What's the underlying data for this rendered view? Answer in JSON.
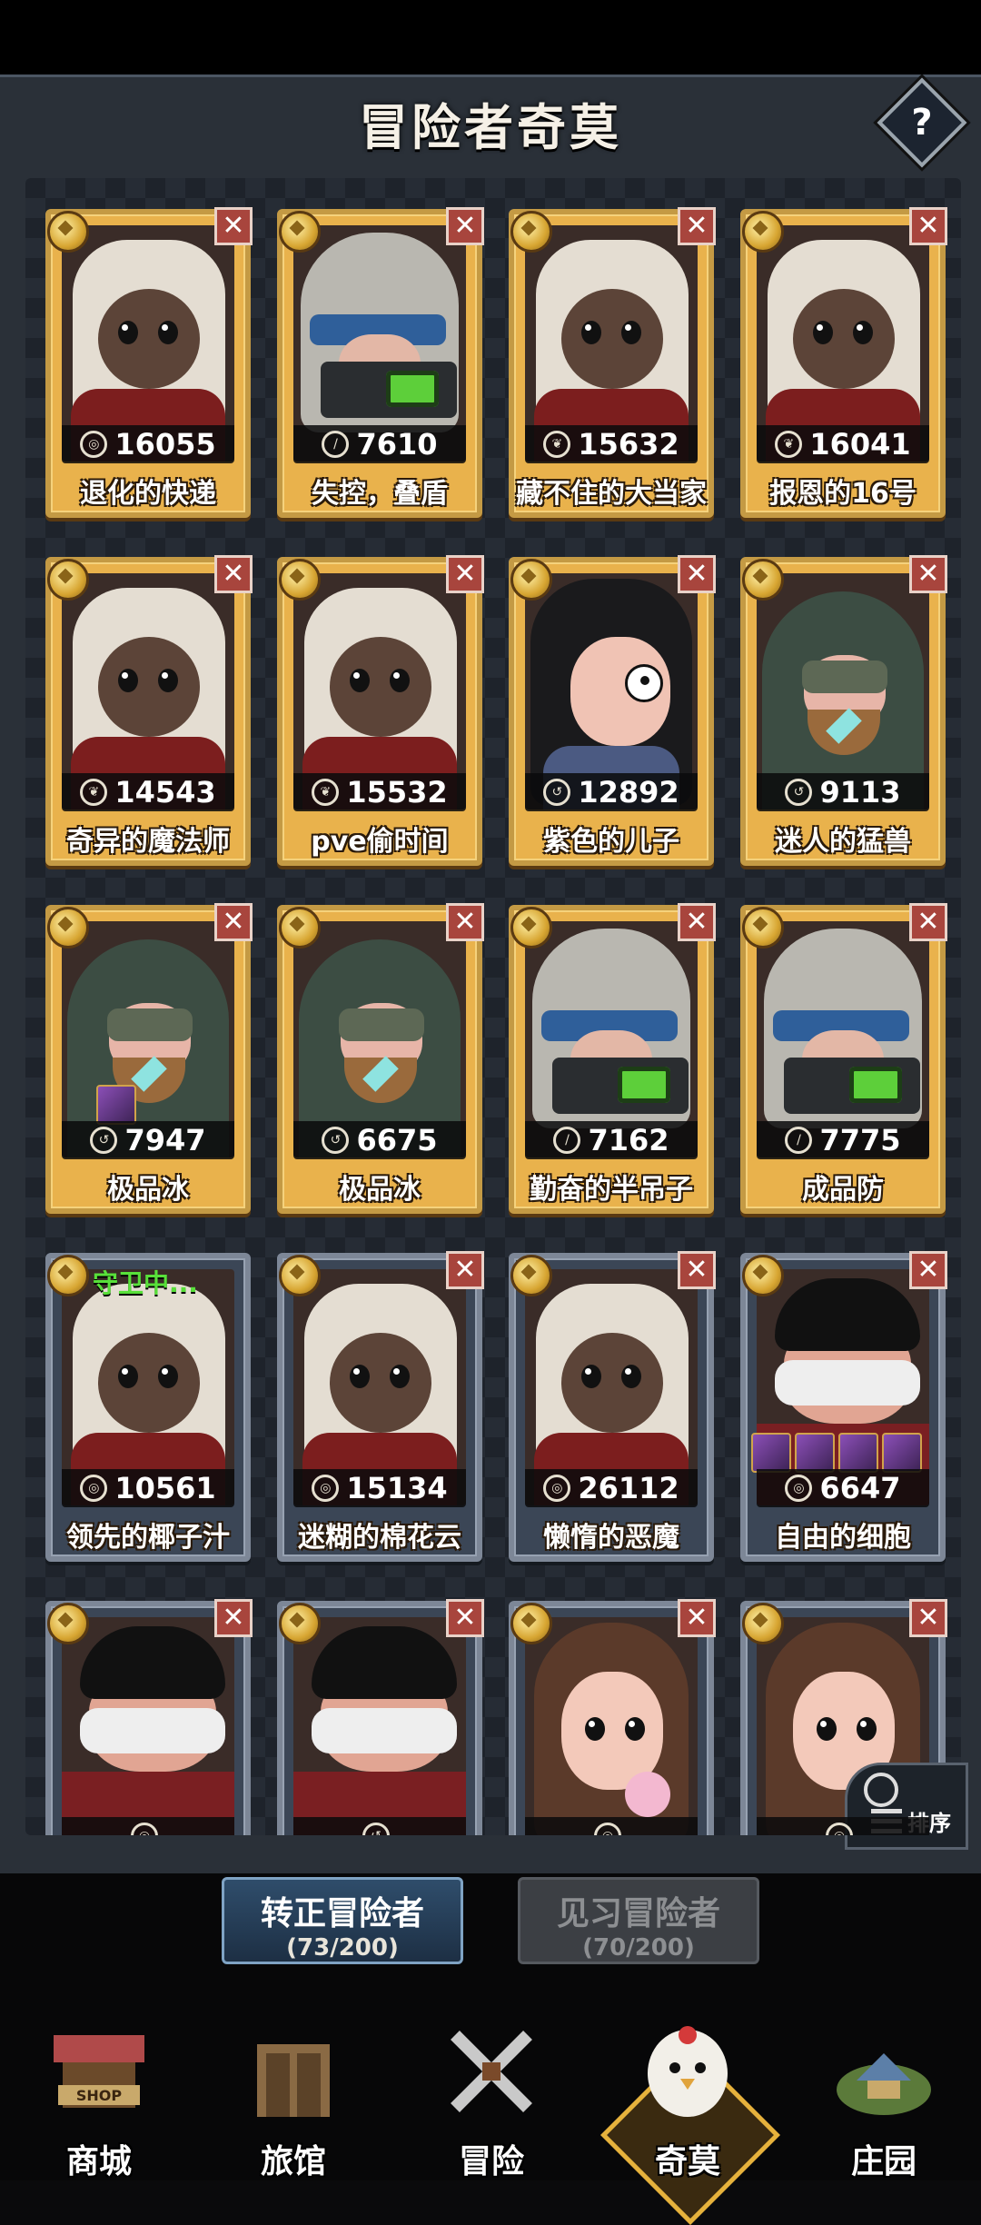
{
  "header": {
    "title": "冒险者奇莫",
    "help_label": "?"
  },
  "cards": [
    {
      "name": "退化的快递",
      "power": "16055",
      "style": "gold",
      "art": "hair-white",
      "stat_icon": "target-icon"
    },
    {
      "name": "失控，叠盾",
      "power": "7610",
      "style": "gold",
      "art": "robot",
      "stat_icon": "sword-icon"
    },
    {
      "name": "藏不住的大当家",
      "power": "15632",
      "style": "gold",
      "art": "hair-white",
      "stat_icon": "leaf-icon"
    },
    {
      "name": "报恩的16号",
      "power": "16041",
      "style": "gold",
      "art": "hair-white",
      "stat_icon": "leaf-icon"
    },
    {
      "name": "奇异的魔法师",
      "power": "14543",
      "style": "gold",
      "art": "hair-white",
      "stat_icon": "leaf-icon"
    },
    {
      "name": "pve偷时间",
      "power": "15532",
      "style": "gold",
      "art": "hair-white",
      "stat_icon": "leaf-icon"
    },
    {
      "name": "紫色的儿子",
      "power": "12892",
      "style": "gold",
      "art": "dark",
      "stat_icon": "staff-icon"
    },
    {
      "name": "迷人的猛兽",
      "power": "9113",
      "style": "gold",
      "art": "hood",
      "stat_icon": "staff-icon"
    },
    {
      "name": "极品冰",
      "power": "7947",
      "style": "gold",
      "art": "hood",
      "stat_icon": "staff-icon"
    },
    {
      "name": "极品冰",
      "power": "6675",
      "style": "gold",
      "art": "hood",
      "stat_icon": "staff-icon"
    },
    {
      "name": "勤奋的半吊子",
      "power": "7162",
      "style": "gold",
      "art": "robot",
      "stat_icon": "sword-icon"
    },
    {
      "name": "成品防",
      "power": "7775",
      "style": "gold",
      "art": "robot",
      "stat_icon": "sword-icon"
    },
    {
      "name": "领先的椰子汁",
      "power": "10561",
      "style": "blue",
      "art": "hair-white",
      "stat_icon": "target-icon",
      "status": "守卫中..."
    },
    {
      "name": "迷糊的棉花云",
      "power": "15134",
      "style": "blue",
      "art": "hair-white",
      "stat_icon": "target-icon"
    },
    {
      "name": "懒惰的恶魔",
      "power": "26112",
      "style": "blue",
      "art": "hair-white",
      "stat_icon": "target-icon"
    },
    {
      "name": "自由的细胞",
      "power": "6647",
      "style": "blue",
      "art": "bandit",
      "stat_icon": "target-icon"
    },
    {
      "name": "",
      "power": "",
      "style": "blue",
      "art": "bandit",
      "stat_icon": "target-icon"
    },
    {
      "name": "",
      "power": "",
      "style": "blue",
      "art": "bandit",
      "stat_icon": "staff-icon"
    },
    {
      "name": "",
      "power": "",
      "style": "blue",
      "art": "girl",
      "stat_icon": "target-icon"
    },
    {
      "name": "",
      "power": "",
      "style": "blue",
      "art": "girl",
      "stat_icon": "target-icon"
    }
  ],
  "close_symbol": "✕",
  "sort": {
    "label": "排序"
  },
  "segments": [
    {
      "label": "转正冒险者",
      "count": "(73/200)",
      "active": true
    },
    {
      "label": "见习冒险者",
      "count": "(70/200)",
      "active": false
    }
  ],
  "nav": [
    {
      "label": "商城",
      "icon": "shop-icon"
    },
    {
      "label": "旅馆",
      "icon": "tavern-icon"
    },
    {
      "label": "冒险",
      "icon": "crossed-swords-icon"
    },
    {
      "label": "奇莫",
      "icon": "chicken-mascot-icon",
      "active": true
    },
    {
      "label": "庄园",
      "icon": "manor-island-icon"
    }
  ],
  "colors": {
    "card_gold": "#e9b24c",
    "card_blue": "#3b4656",
    "close_red": "#a8453d",
    "guard_green": "#58e03a",
    "active_tab": "#2f4d6b"
  }
}
